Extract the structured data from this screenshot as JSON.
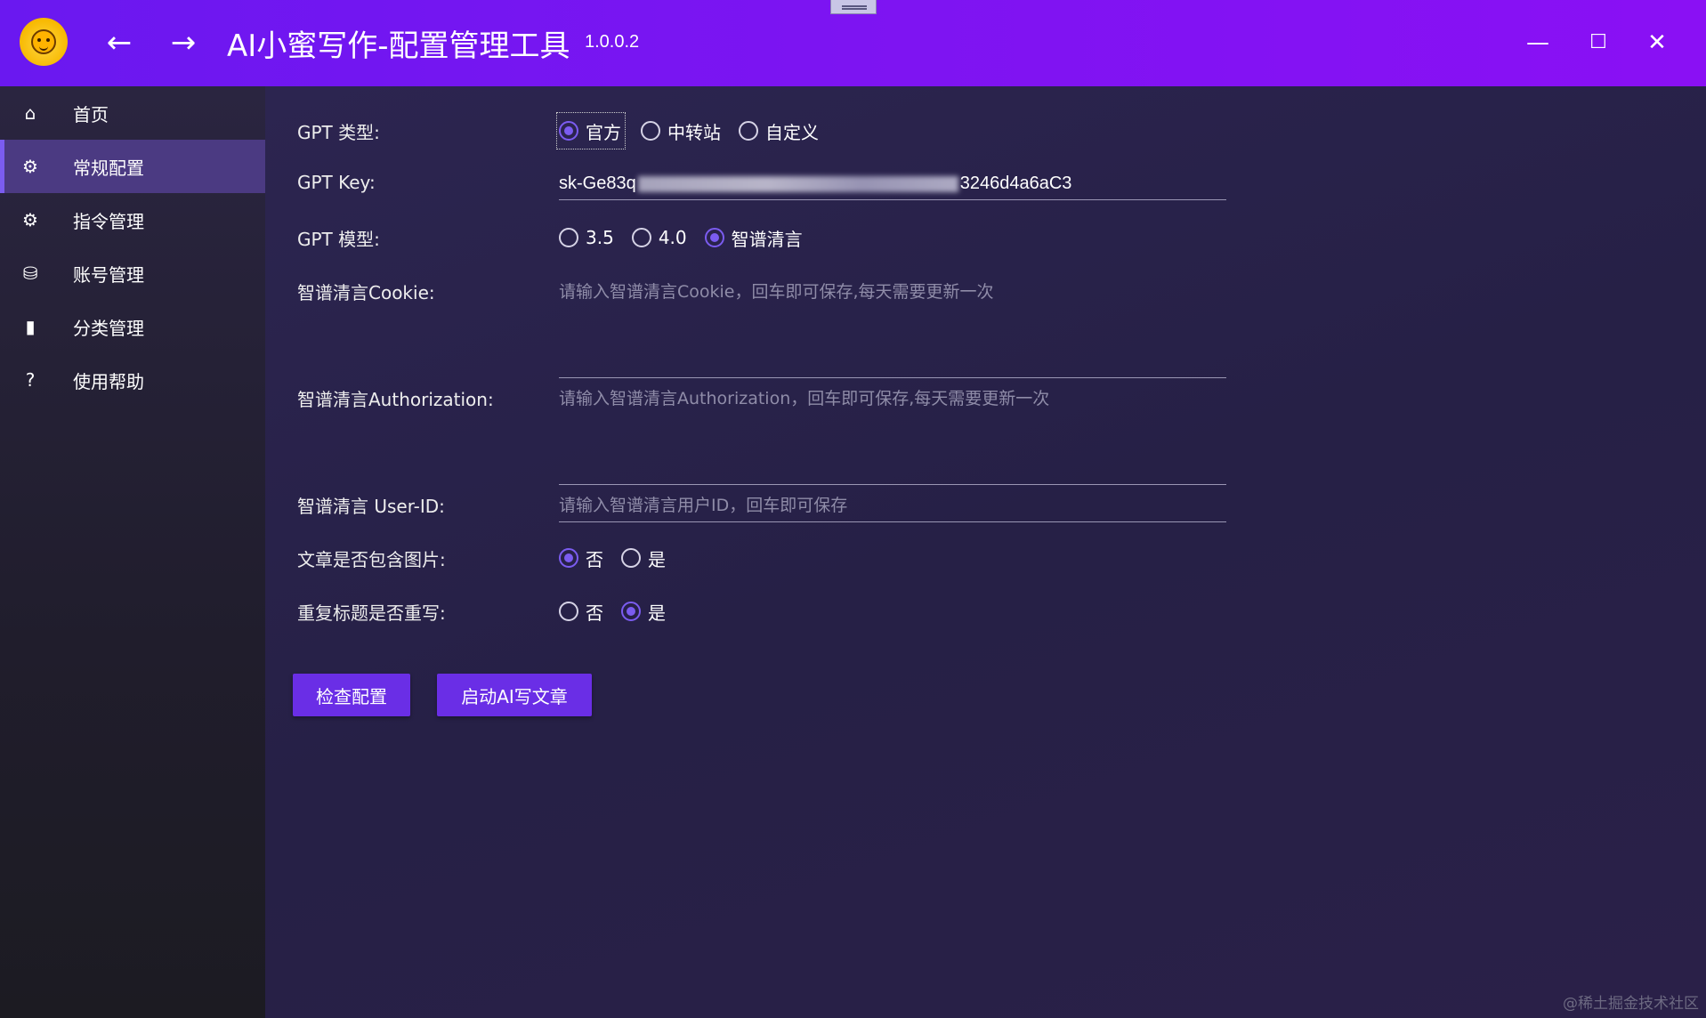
{
  "window": {
    "title": "AI小蜜写作-配置管理工具",
    "version": "1.0.0.2",
    "logo_icon": "pineapple-face-logo",
    "controls": {
      "minimize": "—",
      "maximize": "☐",
      "close": "✕"
    }
  },
  "nav": {
    "back": "←",
    "forward": "→"
  },
  "sidebar": {
    "items": [
      {
        "label": "首页",
        "icon": "home-icon",
        "glyph": "⌂",
        "active": false
      },
      {
        "label": "常规配置",
        "icon": "gear-icon",
        "glyph": "⚙",
        "active": true
      },
      {
        "label": "指令管理",
        "icon": "gear-icon",
        "glyph": "⚙",
        "active": false
      },
      {
        "label": "账号管理",
        "icon": "account-icon",
        "glyph": "⛁",
        "active": false
      },
      {
        "label": "分类管理",
        "icon": "book-icon",
        "glyph": "▮",
        "active": false
      },
      {
        "label": "使用帮助",
        "icon": "help-icon",
        "glyph": "?",
        "active": false
      }
    ]
  },
  "form": {
    "gpt_type": {
      "label": "GPT 类型:",
      "options": [
        "官方",
        "中转站",
        "自定义"
      ],
      "selected": "官方"
    },
    "gpt_key": {
      "label": "GPT Key:",
      "value_prefix": "sk-Ge83q",
      "value_suffix": "3246d4a6aC3"
    },
    "gpt_model": {
      "label": "GPT 模型:",
      "options": [
        "3.5",
        "4.0",
        "智谱清言"
      ],
      "selected": "智谱清言"
    },
    "zhipu_cookie": {
      "label": "智谱清言Cookie:",
      "placeholder": "请输入智谱清言Cookie，回车即可保存,每天需要更新一次"
    },
    "zhipu_authorization": {
      "label": "智谱清言Authorization:",
      "placeholder": "请输入智谱清言Authorization，回车即可保存,每天需要更新一次"
    },
    "zhipu_user_id": {
      "label": "智谱清言 User-ID:",
      "placeholder": "请输入智谱清言用户ID，回车即可保存"
    },
    "include_images": {
      "label": "文章是否包含图片:",
      "options": [
        "否",
        "是"
      ],
      "selected": "否"
    },
    "rewrite_titles": {
      "label": "重复标题是否重写:",
      "options": [
        "否",
        "是"
      ],
      "selected": "是"
    }
  },
  "buttons": {
    "check_config": "检查配置",
    "start_writing": "启动AI写文章"
  },
  "colors": {
    "titlebar": "#7d14f2",
    "accent": "#7b5cf0",
    "button": "#6a2ee6",
    "sidebar_active": "#4b3a82"
  },
  "watermark": "@稀土掘金技术社区"
}
